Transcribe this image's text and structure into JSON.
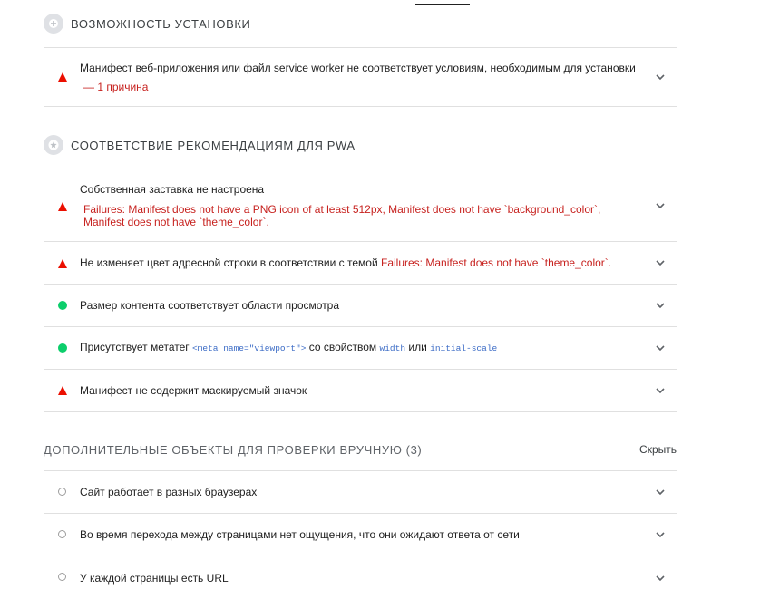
{
  "installable": {
    "title": "ВОЗМОЖНОСТЬ УСТАНОВКИ",
    "audits": [
      {
        "title": "Манифест веб-приложения или файл service worker не соответствует условиям, необходимым для установки",
        "detail": "— 1 причина",
        "status": "fail"
      }
    ]
  },
  "pwa_optimized": {
    "title": "СООТВЕТСТВИЕ РЕКОМЕНДАЦИЯМ ДЛЯ PWA",
    "audits": [
      {
        "title": "Собственная заставка не настроена",
        "detail": "Failures: Manifest does not have a PNG icon of at least 512px, Manifest does not have `background_color`, Manifest does not have `theme_color`.",
        "status": "fail"
      },
      {
        "title": "Не изменяет цвет адресной строки в соответствии с темой",
        "detail": "Failures: Manifest does not have `theme_color`.",
        "status": "fail"
      },
      {
        "title": "Размер контента соответствует области просмотра",
        "status": "pass"
      },
      {
        "title_parts": [
          "Присутствует метатег ",
          "<meta name=\"viewport\">",
          " со свойством ",
          "width",
          " или ",
          "initial-scale"
        ],
        "status": "pass"
      },
      {
        "title": "Манифест не содержит маскируемый значок",
        "status": "fail"
      }
    ]
  },
  "manual": {
    "title": "ДОПОЛНИТЕЛЬНЫЕ ОБЪЕКТЫ ДЛЯ ПРОВЕРКИ ВРУЧНУЮ",
    "count": "(3)",
    "hide_label": "Скрыть",
    "items": [
      "Сайт работает в разных браузерах",
      "Во время перехода между страницами нет ощущения, что они ожидают ответа от сети",
      "У каждой страницы есть URL"
    ]
  },
  "colors": {
    "fail": "#eb0f00",
    "pass": "#0cce6b",
    "error_text": "#c7221f",
    "code": "#3c6cc6"
  },
  "icons": {
    "installable_group": "plus-circle-icon",
    "pwa_group": "star-icon",
    "expand": "chevron-down-icon"
  }
}
